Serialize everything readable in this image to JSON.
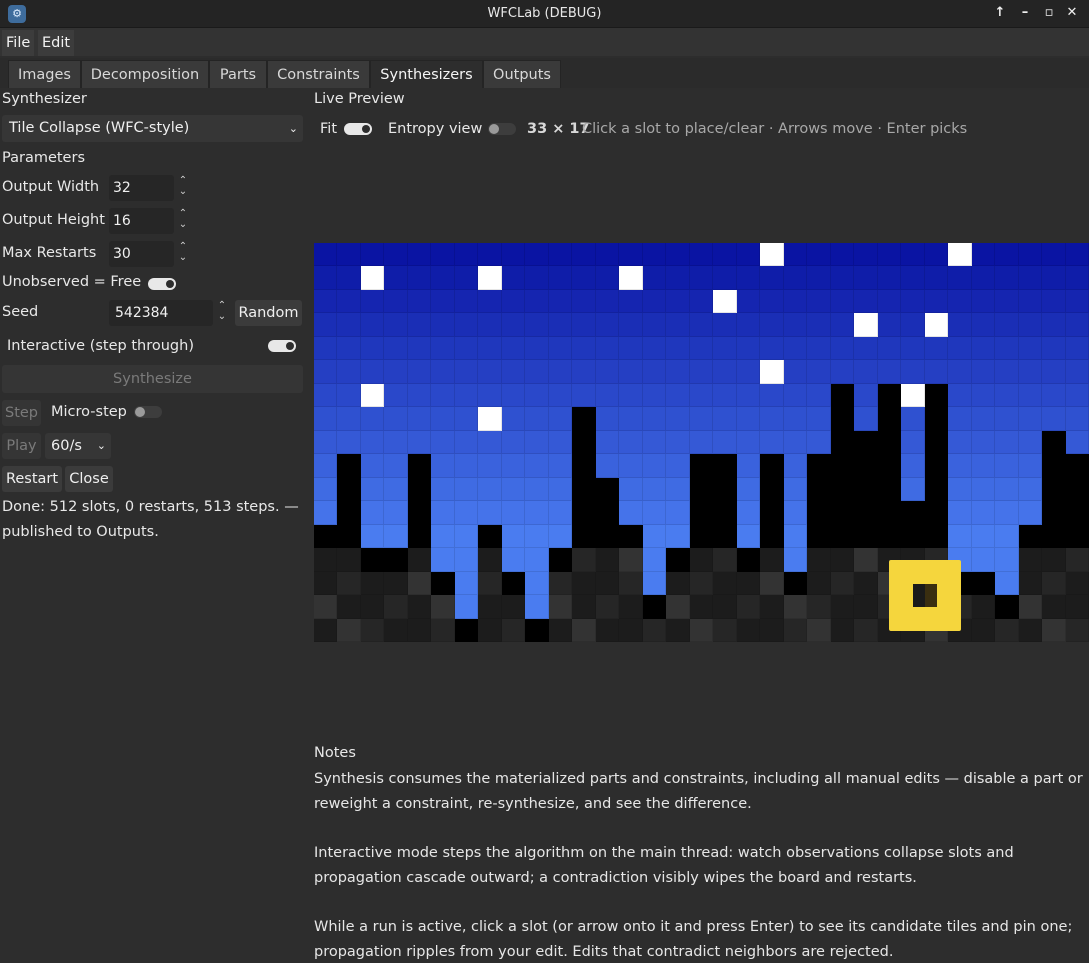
{
  "window": {
    "title": "WFCLab (DEBUG)",
    "app_icon": "godot-icon",
    "controls": [
      "↑",
      "–",
      "▫",
      "✕"
    ]
  },
  "menu": [
    "File",
    "Edit"
  ],
  "tabs": [
    "Images",
    "Decomposition",
    "Parts",
    "Constraints",
    "Synthesizers",
    "Outputs"
  ],
  "active_tab": "Synthesizers",
  "left": {
    "synthesizer_heading": "Synthesizer",
    "synth_select_value": "Tile Collapse (WFC-style)",
    "parameters_heading": "Parameters",
    "output_width_label": "Output Width",
    "output_width_value": "32",
    "output_height_label": "Output Height",
    "output_height_value": "16",
    "max_restarts_label": "Max Restarts",
    "max_restarts_value": "30",
    "unobserved_label": "Unobserved = Free",
    "unobserved_on": true,
    "seed_label": "Seed",
    "seed_value": "542384",
    "random_button": "Random",
    "interactive_label": "Interactive (step through)",
    "interactive_on": true,
    "synthesize_button": "Synthesize",
    "step_button": "Step",
    "microstep_label": "Micro-step",
    "microstep_on": false,
    "play_button": "Play",
    "speed_value": "60/s",
    "restart_button": "Restart",
    "close_button": "Close",
    "status_line1": "Done: 512 slots, 0 restarts, 513 steps. —",
    "status_line2": "published to Outputs."
  },
  "preview": {
    "heading": "Live Preview",
    "fit_label": "Fit",
    "fit_on": true,
    "entropy_label": "Entropy view",
    "entropy_on": false,
    "grid_size": "33 × 17",
    "hint": "Click a slot to place/clear · Arrows move · Enter picks",
    "cols": 33,
    "rows": 17,
    "cursor": {
      "col": 25,
      "row": 14
    },
    "colors": {
      "sky_top": "#0a14a3",
      "sky_bottom": "#4a7cf0",
      "star": "#ffffff",
      "building": "#000000",
      "ground_dark": "#1c1c1c",
      "ground_light": "#333333",
      "cursor": "#f5d63d"
    },
    "stars": [
      [
        19,
        0
      ],
      [
        27,
        0
      ],
      [
        2,
        1
      ],
      [
        7,
        1
      ],
      [
        13,
        1
      ],
      [
        17,
        2
      ],
      [
        23,
        3
      ],
      [
        26,
        3
      ],
      [
        19,
        5
      ],
      [
        2,
        6
      ],
      [
        25,
        6
      ],
      [
        7,
        7
      ]
    ],
    "building_tops": [
      12,
      9,
      13,
      13,
      9,
      14,
      16,
      12,
      14,
      16,
      13,
      7,
      10,
      12,
      15,
      13,
      9,
      9,
      13,
      9,
      14,
      9,
      6,
      8,
      6,
      11,
      6,
      14,
      14,
      15,
      12,
      8,
      9
    ]
  },
  "notes": {
    "heading": "Notes",
    "p1_l1": "Synthesis consumes the materialized parts and constraints, including all manual edits — disable a part or",
    "p1_l2": "reweight a constraint, re-synthesize, and see the difference.",
    "p2_l1": "Interactive mode steps the algorithm on the main thread: watch observations collapse slots and",
    "p2_l2": "propagation cascade outward; a contradiction visibly wipes the board and restarts.",
    "p3_l1": "While a run is active, click a slot (or arrow onto it and press Enter) to see its candidate tiles and pin one;",
    "p3_l2": "propagation ripples from your edit. Edits that contradict neighbors are rejected."
  }
}
